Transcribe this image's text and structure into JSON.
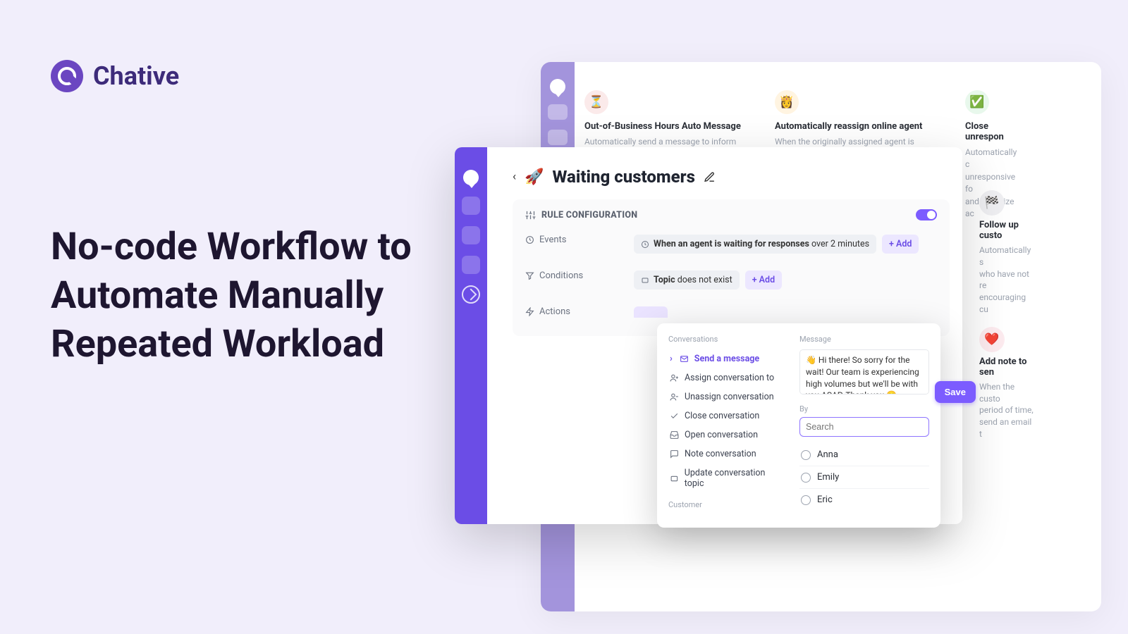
{
  "brand": {
    "name": "Chative"
  },
  "headline": "No-code Workflow to Automate Manually Repeated Workload",
  "rear_cards": [
    {
      "icon": "⏳",
      "title": "Out-of-Business Hours Auto Message",
      "desc": "Automatically send a message to inform customers"
    },
    {
      "icon": "👸",
      "title": "Automatically reassign online agent",
      "desc": "When the originally assigned agent is unavailable,"
    },
    {
      "icon": "✅",
      "title": "Close unrespon",
      "desc": "Automatically c\nunresponsive fo\nand prioritize ac"
    }
  ],
  "rear_side": [
    {
      "icon": "🏁",
      "iconbg": "#EFEFF2",
      "title": "Follow up custo",
      "desc": "Automatically s\nwho have not re\nencouraging cu"
    },
    {
      "icon": "❤️",
      "iconbg": "#FDEBEF",
      "title": "Add note to sen",
      "desc": "When the custo\nperiod of time,\nsend an email t"
    }
  ],
  "front": {
    "title": "Waiting customers",
    "rule_heading": "RULE CONFIGURATION",
    "toggle_on": true,
    "labels": {
      "events": "Events",
      "conditions": "Conditions",
      "actions": "Actions"
    },
    "event_chip": {
      "bold": "When an agent is waiting for responses",
      "tail": " over 2 minutes"
    },
    "condition_chip": {
      "bold": "Topic",
      "tail": " does not exist"
    },
    "add_label": "+ Add",
    "popover": {
      "section": "Conversations",
      "items": [
        "Send a message",
        "Assign conversation to",
        "Unassign conversation",
        "Close conversation",
        "Open conversation",
        "Note conversation",
        "Update conversation topic"
      ],
      "section2": "Customer",
      "message_label": "Message",
      "message_value": "👋 Hi there! So sorry for the wait! Our team is experiencing high volumes but we'll be with you ASAP. Thank you 😊",
      "by_label": "By",
      "search_placeholder": "Search",
      "options": [
        "Anna",
        "Emily",
        "Eric"
      ],
      "save": "Save"
    }
  }
}
